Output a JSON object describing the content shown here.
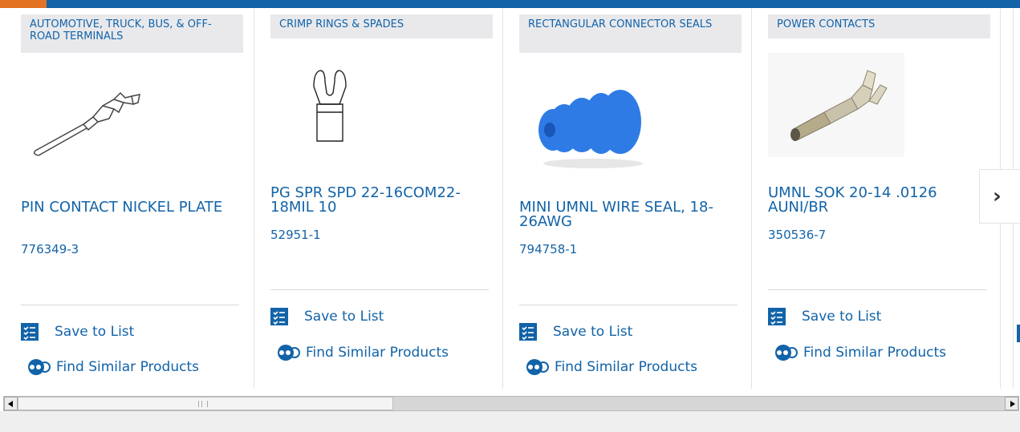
{
  "colors": {
    "brand_blue": "#1263a8",
    "accent_orange": "#e37222",
    "category_bg": "#e9e9ec"
  },
  "cards": [
    {
      "category": "AUTOMOTIVE, TRUCK, BUS, & OFF-ROAD TERMINALS",
      "title": "PIN CONTACT NICKEL PLATE",
      "part_number": "776349-3",
      "save_label": "Save to List",
      "similar_label": "Find Similar Products",
      "image_icon": "pin-contact-terminal"
    },
    {
      "category": "CRIMP RINGS & SPADES",
      "title": "PG SPR SPD 22-16COM22-18MIL 10",
      "part_number": "52951-1",
      "save_label": "Save to List",
      "similar_label": "Find Similar Products",
      "image_icon": "spade-terminal"
    },
    {
      "category": "RECTANGULAR CONNECTOR SEALS",
      "title": "MINI UMNL WIRE SEAL, 18-26AWG",
      "part_number": "794758-1",
      "save_label": "Save to List",
      "similar_label": "Find Similar Products",
      "image_icon": "blue-wire-seal"
    },
    {
      "category": "POWER CONTACTS",
      "title": "UMNL SOK 20-14 .0126 AUNI/BR",
      "part_number": "350536-7",
      "save_label": "Save to List",
      "similar_label": "Find Similar Products",
      "image_icon": "socket-contact"
    }
  ],
  "next_button": {
    "label": "›",
    "icon": "chevron-right-icon"
  }
}
